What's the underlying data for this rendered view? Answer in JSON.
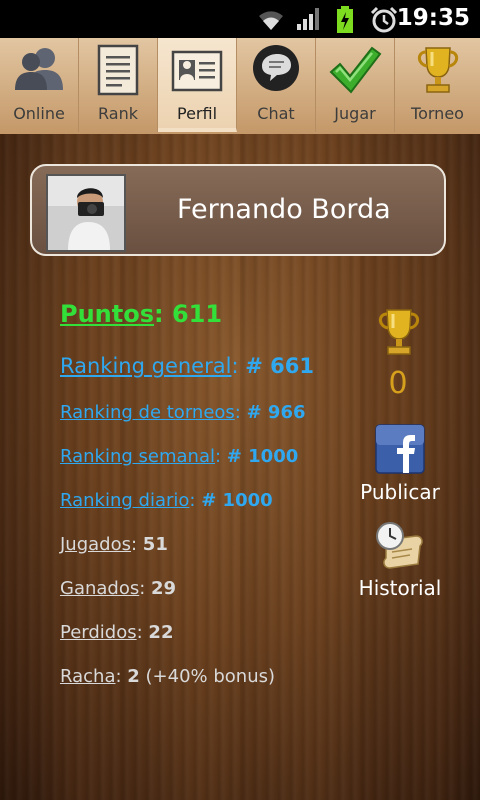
{
  "status_bar": {
    "time": "19:35"
  },
  "tabs": [
    {
      "label": "Online",
      "icon": "users-icon"
    },
    {
      "label": "Rank",
      "icon": "ranking-document-icon"
    },
    {
      "label": "Perfil",
      "icon": "profile-card-icon",
      "active": true
    },
    {
      "label": "Chat",
      "icon": "chat-bubble-icon"
    },
    {
      "label": "Jugar",
      "icon": "checkmark-icon"
    },
    {
      "label": "Torneo",
      "icon": "trophy-icon"
    }
  ],
  "profile": {
    "name": "Fernando Borda"
  },
  "stats": {
    "puntos": {
      "label": "Puntos",
      "sep": ": ",
      "value": "611"
    },
    "ranking_general": {
      "label": "Ranking general",
      "sep": ": ",
      "value": "# 661"
    },
    "ranking_torneos": {
      "label": "Ranking de torneos",
      "sep": ": ",
      "value": "# 966"
    },
    "ranking_semanal": {
      "label": "Ranking semanal",
      "sep": ": ",
      "value": "# 1000"
    },
    "ranking_diario": {
      "label": "Ranking diario",
      "sep": ": ",
      "value": "# 1000"
    },
    "jugados": {
      "label": "Jugados",
      "sep": ": ",
      "value": "51"
    },
    "ganados": {
      "label": "Ganados",
      "sep": ": ",
      "value": "29"
    },
    "perdidos": {
      "label": "Perdidos",
      "sep": ": ",
      "value": "22"
    },
    "racha": {
      "label": "Racha",
      "sep": ": ",
      "value": "2",
      "extra": " (+40% bonus)"
    }
  },
  "side": {
    "trophy_count": "0",
    "publicar_label": "Publicar",
    "historial_label": "Historial"
  },
  "colors": {
    "link_blue": "#2fa8f0",
    "points_green": "#33e03a",
    "trophy_gold": "#d6a01c"
  }
}
